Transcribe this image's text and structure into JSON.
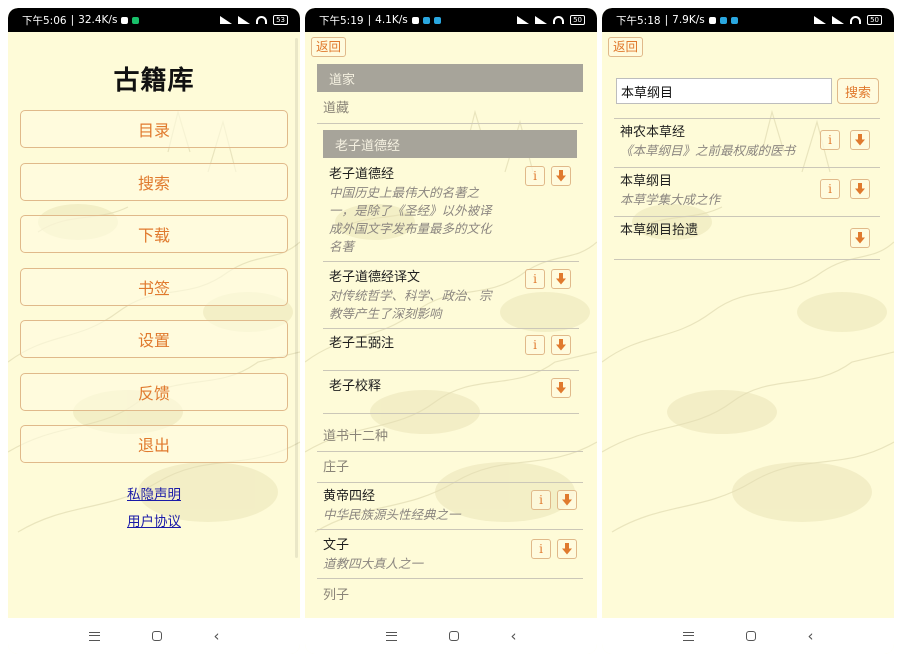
{
  "screens": [
    {
      "status": {
        "time": "下午5:06",
        "speed": "32.4K/s",
        "battery": "53"
      },
      "title": "古籍库",
      "menu": [
        "目录",
        "搜索",
        "下载",
        "书签",
        "设置",
        "反馈",
        "退出"
      ],
      "links": [
        "私隐声明",
        "用户协议"
      ]
    },
    {
      "status": {
        "time": "下午5:19",
        "speed": "4.1K/s",
        "battery": "50"
      },
      "back": "返回",
      "category": "道家",
      "subcategory": "道藏",
      "group": "老子道德经",
      "entries": [
        {
          "title": "老子道德经",
          "lines": [
            "中国历史上最伟大的名著之",
            "一，是除了《圣经》以外被译",
            "成外国文字发布量最多的文化",
            "名著"
          ]
        },
        {
          "title": "老子道德经译文",
          "lines": [
            "对传统哲学、科学、政治、宗",
            "教等产生了深刻影响"
          ]
        },
        {
          "title": "老子王弼注",
          "lines": []
        },
        {
          "title": "老子校释",
          "lines": []
        }
      ],
      "cat2": "道书十二种",
      "cat3": "庄子",
      "entries2": [
        {
          "title": "黄帝四经",
          "lines": [
            "中华民族源头性经典之一"
          ]
        },
        {
          "title": "文子",
          "lines": [
            "道教四大真人之一"
          ]
        }
      ],
      "cat4": "列子"
    },
    {
      "status": {
        "time": "下午5:18",
        "speed": "7.9K/s",
        "battery": "50"
      },
      "back": "返回",
      "search_value": "本草纲目",
      "search_btn": "搜索",
      "results": [
        {
          "title": "神农本草经",
          "desc": "《本草纲目》之前最权威的医书"
        },
        {
          "title": "本草纲目",
          "desc": "本草学集大成之作"
        },
        {
          "title": "本草纲目拾遗",
          "desc": ""
        }
      ]
    }
  ],
  "icons": {
    "info": "i",
    "download": "download-arrow-icon"
  },
  "colors": {
    "accent": "#e07a2e",
    "border": "#e0b98a",
    "paper": "#fefbd8",
    "header": "#a7a49a"
  }
}
